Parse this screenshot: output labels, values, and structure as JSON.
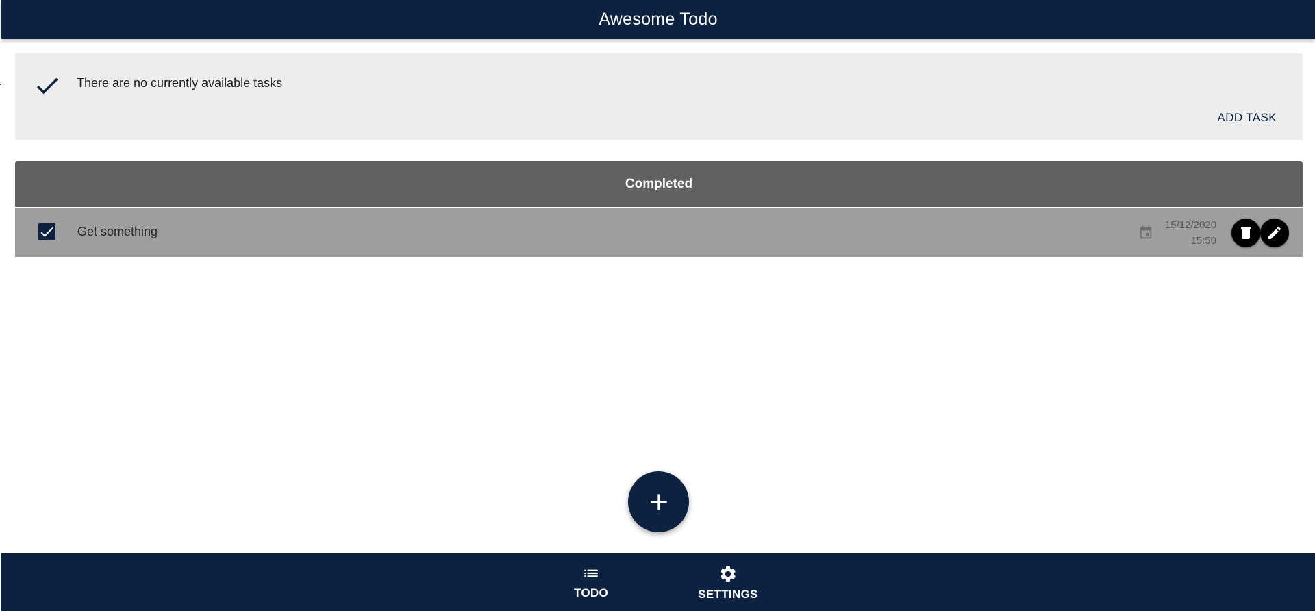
{
  "app": {
    "title": "Awesome Todo"
  },
  "banner": {
    "message": "There are no currently available tasks",
    "icon": "check-icon",
    "action_label": "ADD TASK"
  },
  "completed": {
    "header": "Completed",
    "items": [
      {
        "label": "Get something",
        "checked": true,
        "date": "15/12/2020",
        "time": "15:50"
      }
    ]
  },
  "fab": {
    "icon": "plus-icon"
  },
  "bottom_nav": {
    "items": [
      {
        "label": "TODO",
        "icon": "list-icon"
      },
      {
        "label": "SETTINGS",
        "icon": "gear-icon"
      }
    ]
  },
  "colors": {
    "primary": "#0b2340",
    "banner_bg": "#ededed",
    "completed_header_bg": "#616161",
    "completed_row_bg": "#9e9e9e"
  }
}
